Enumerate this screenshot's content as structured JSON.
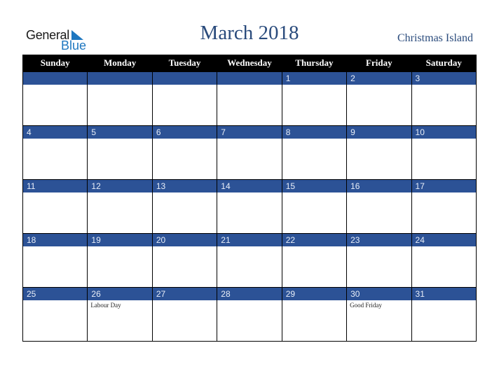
{
  "logo": {
    "general": "General",
    "blue": "Blue"
  },
  "title": "March 2018",
  "region": "Christmas Island",
  "colors": {
    "header_bg": "#000000",
    "date_band": "#2c5296",
    "title": "#2a4b7c",
    "logo_blue": "#1e77c0"
  },
  "weekdays": [
    "Sunday",
    "Monday",
    "Tuesday",
    "Wednesday",
    "Thursday",
    "Friday",
    "Saturday"
  ],
  "weeks": [
    [
      {
        "day": ""
      },
      {
        "day": ""
      },
      {
        "day": ""
      },
      {
        "day": ""
      },
      {
        "day": "1"
      },
      {
        "day": "2"
      },
      {
        "day": "3"
      }
    ],
    [
      {
        "day": "4"
      },
      {
        "day": "5"
      },
      {
        "day": "6"
      },
      {
        "day": "7"
      },
      {
        "day": "8"
      },
      {
        "day": "9"
      },
      {
        "day": "10"
      }
    ],
    [
      {
        "day": "11"
      },
      {
        "day": "12"
      },
      {
        "day": "13"
      },
      {
        "day": "14"
      },
      {
        "day": "15"
      },
      {
        "day": "16"
      },
      {
        "day": "17"
      }
    ],
    [
      {
        "day": "18"
      },
      {
        "day": "19"
      },
      {
        "day": "20"
      },
      {
        "day": "21"
      },
      {
        "day": "22"
      },
      {
        "day": "23"
      },
      {
        "day": "24"
      }
    ],
    [
      {
        "day": "25"
      },
      {
        "day": "26",
        "event": "Labour Day"
      },
      {
        "day": "27"
      },
      {
        "day": "28"
      },
      {
        "day": "29"
      },
      {
        "day": "30",
        "event": "Good Friday"
      },
      {
        "day": "31"
      }
    ]
  ]
}
